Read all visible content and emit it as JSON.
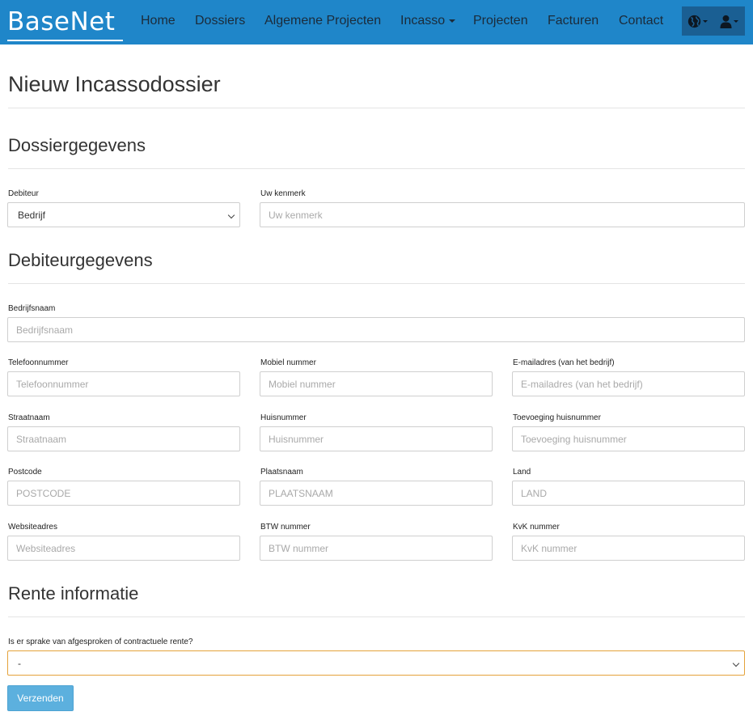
{
  "brand": {
    "name": "BaseNet"
  },
  "nav": {
    "home": "Home",
    "dossiers": "Dossiers",
    "algemene_projecten": "Algemene Projecten",
    "incasso": "Incasso",
    "projecten": "Projecten",
    "facturen": "Facturen",
    "contact": "Contact"
  },
  "tools": {
    "language_icon": "globe-icon",
    "user_icon": "user-icon"
  },
  "page": {
    "title": "Nieuw Incassodossier"
  },
  "sections": {
    "dossier": "Dossiergegevens",
    "debiteur": "Debiteurgegevens",
    "rente": "Rente informatie"
  },
  "dossier": {
    "debiteur_label": "Debiteur",
    "debiteur_value": "Bedrijf",
    "kenmerk_label": "Uw kenmerk",
    "kenmerk_placeholder": "Uw kenmerk"
  },
  "debiteur": {
    "bedrijfsnaam_label": "Bedrijfsnaam",
    "bedrijfsnaam_placeholder": "Bedrijfsnaam",
    "telefoon_label": "Telefoonnummer",
    "telefoon_placeholder": "Telefoonnummer",
    "mobiel_label": "Mobiel nummer",
    "mobiel_placeholder": "Mobiel nummer",
    "email_label": "E-mailadres (van het bedrijf)",
    "email_placeholder": "E-mailadres (van het bedrijf)",
    "straat_label": "Straatnaam",
    "straat_placeholder": "Straatnaam",
    "huisnummer_label": "Huisnummer",
    "huisnummer_placeholder": "Huisnummer",
    "toevoeging_label": "Toevoeging huisnummer",
    "toevoeging_placeholder": "Toevoeging huisnummer",
    "postcode_label": "Postcode",
    "postcode_placeholder": "POSTCODE",
    "plaats_label": "Plaatsnaam",
    "plaats_placeholder": "PLAATSNAAM",
    "land_label": "Land",
    "land_placeholder": "LAND",
    "website_label": "Websiteadres",
    "website_placeholder": "Websiteadres",
    "btw_label": "BTW nummer",
    "btw_placeholder": "BTW nummer",
    "kvk_label": "KvK nummer",
    "kvk_placeholder": "KvK nummer"
  },
  "rente": {
    "question_label": "Is er sprake van afgesproken of contractuele rente?",
    "question_value": "-"
  },
  "submit": {
    "label": "Verzenden"
  },
  "colors": {
    "navbar": "#1f86c9",
    "button": "#5cb0de",
    "focus_border": "#e4a23a"
  }
}
